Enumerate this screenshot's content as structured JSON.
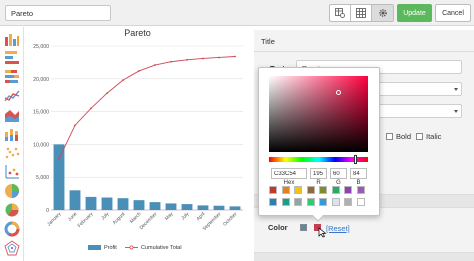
{
  "toolbar": {
    "title_value": "Pareto",
    "update_label": "Update",
    "cancel_label": "Cancel",
    "tool_icons": [
      "table-settings-icon",
      "grid-icon",
      "gear-icon"
    ]
  },
  "sidebar": {
    "chart_types": [
      "column-chart-icon",
      "bar-chart-icon",
      "stacked-bar-icon",
      "line-chart-icon",
      "area-chart-icon",
      "stacked-column-icon",
      "scatter-chart-icon",
      "bubble-chart-icon",
      "axis-chart-icon",
      "pie-chart-icon",
      "donut-chart-icon",
      "radar-chart-icon"
    ]
  },
  "chart_data": {
    "type": "bar",
    "title": "Pareto",
    "categories": [
      "January",
      "June",
      "February",
      "July",
      "August",
      "March",
      "December",
      "May",
      "July",
      "April",
      "September",
      "October"
    ],
    "series": [
      {
        "name": "Profit",
        "type": "bar",
        "values": [
          10000,
          3000,
          2000,
          1900,
          1800,
          1500,
          1200,
          1000,
          900,
          700,
          650,
          550
        ]
      },
      {
        "name": "Cumulative Total",
        "type": "line",
        "values": [
          7800,
          12900,
          15500,
          17800,
          19800,
          21200,
          22100,
          22600,
          22900,
          23100,
          23250,
          23400
        ]
      }
    ],
    "ylim": [
      0,
      25000
    ],
    "yticks": [
      "0",
      "5,000",
      "10,000",
      "15,000",
      "20,000",
      "25,000"
    ],
    "colors": {
      "bar": "#4a8fb8",
      "line": "#c94a55"
    },
    "grid": true,
    "legend": "bottom"
  },
  "panel": {
    "header": "Title",
    "text_label": "Text",
    "text_value": "Pareto",
    "bold_label": "Bold",
    "italic_label": "Italic",
    "color_label": "Color",
    "reset_label": "[Reset]",
    "current_color": "#C33C54"
  },
  "picker": {
    "hex_value": "C33C54",
    "r_value": "195",
    "g_value": "60",
    "b_value": "84",
    "hex_label": "Hex",
    "r_label": "R",
    "g_label": "G",
    "b_label": "B",
    "presets_row1": [
      "#c0392b",
      "#e67e22",
      "#f1c40f",
      "#8e6b3a",
      "#7f8c2b",
      "#27ae60",
      "#8e44ad",
      "#9b59b6"
    ],
    "presets_row2": [
      "#2980b9",
      "#16a085",
      "#95a5a6",
      "#2ecc71",
      "#3498db",
      "#dde3ea",
      "#b0b0b0",
      "#ffffff"
    ]
  }
}
